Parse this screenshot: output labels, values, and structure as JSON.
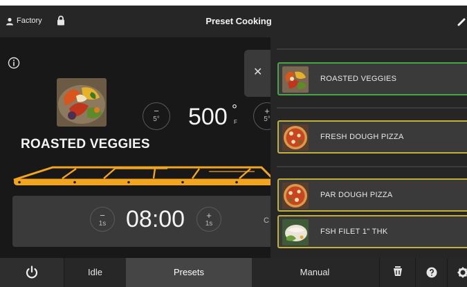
{
  "header": {
    "user_label": "Factory",
    "title": "Preset Cooking",
    "user_icon": "user-icon",
    "lock_icon": "lock-icon",
    "collapse_icon": "chevron-icon"
  },
  "selected_preset": {
    "name": "ROASTED VEGGIES",
    "temperature": {
      "value": "500",
      "degree_symbol": "°",
      "unit": "F",
      "step": "5°"
    },
    "timer": {
      "value": "08:00",
      "step": "1s",
      "cut_off_label": "C"
    }
  },
  "preset_list": {
    "items": [
      {
        "label": "ROASTED VEGGIES",
        "selected": true,
        "image": "roasted-veggies-thumb"
      },
      {
        "label": "FRESH DOUGH PIZZA",
        "selected": false,
        "image": "pizza-thumb"
      },
      {
        "label": "PAR DOUGH PIZZA",
        "selected": false,
        "image": "pizza-thumb"
      },
      {
        "label": "FSH FILET 1\" THK",
        "selected": false,
        "image": "fish-thumb"
      }
    ]
  },
  "bottom_nav": {
    "power_icon": "power-icon",
    "idle_label": "Idle",
    "presets_label": "Presets",
    "manual_label": "Manual",
    "cleaning_icon": "cleaning-icon",
    "help_icon": "help-icon",
    "settings_icon": "gear-icon"
  },
  "colors": {
    "background": "#181818",
    "panel": "#3a3a3a",
    "accent_orange": "#f2a51f",
    "selected_border": "#4ba34a",
    "item_border": "#c2b13a"
  }
}
